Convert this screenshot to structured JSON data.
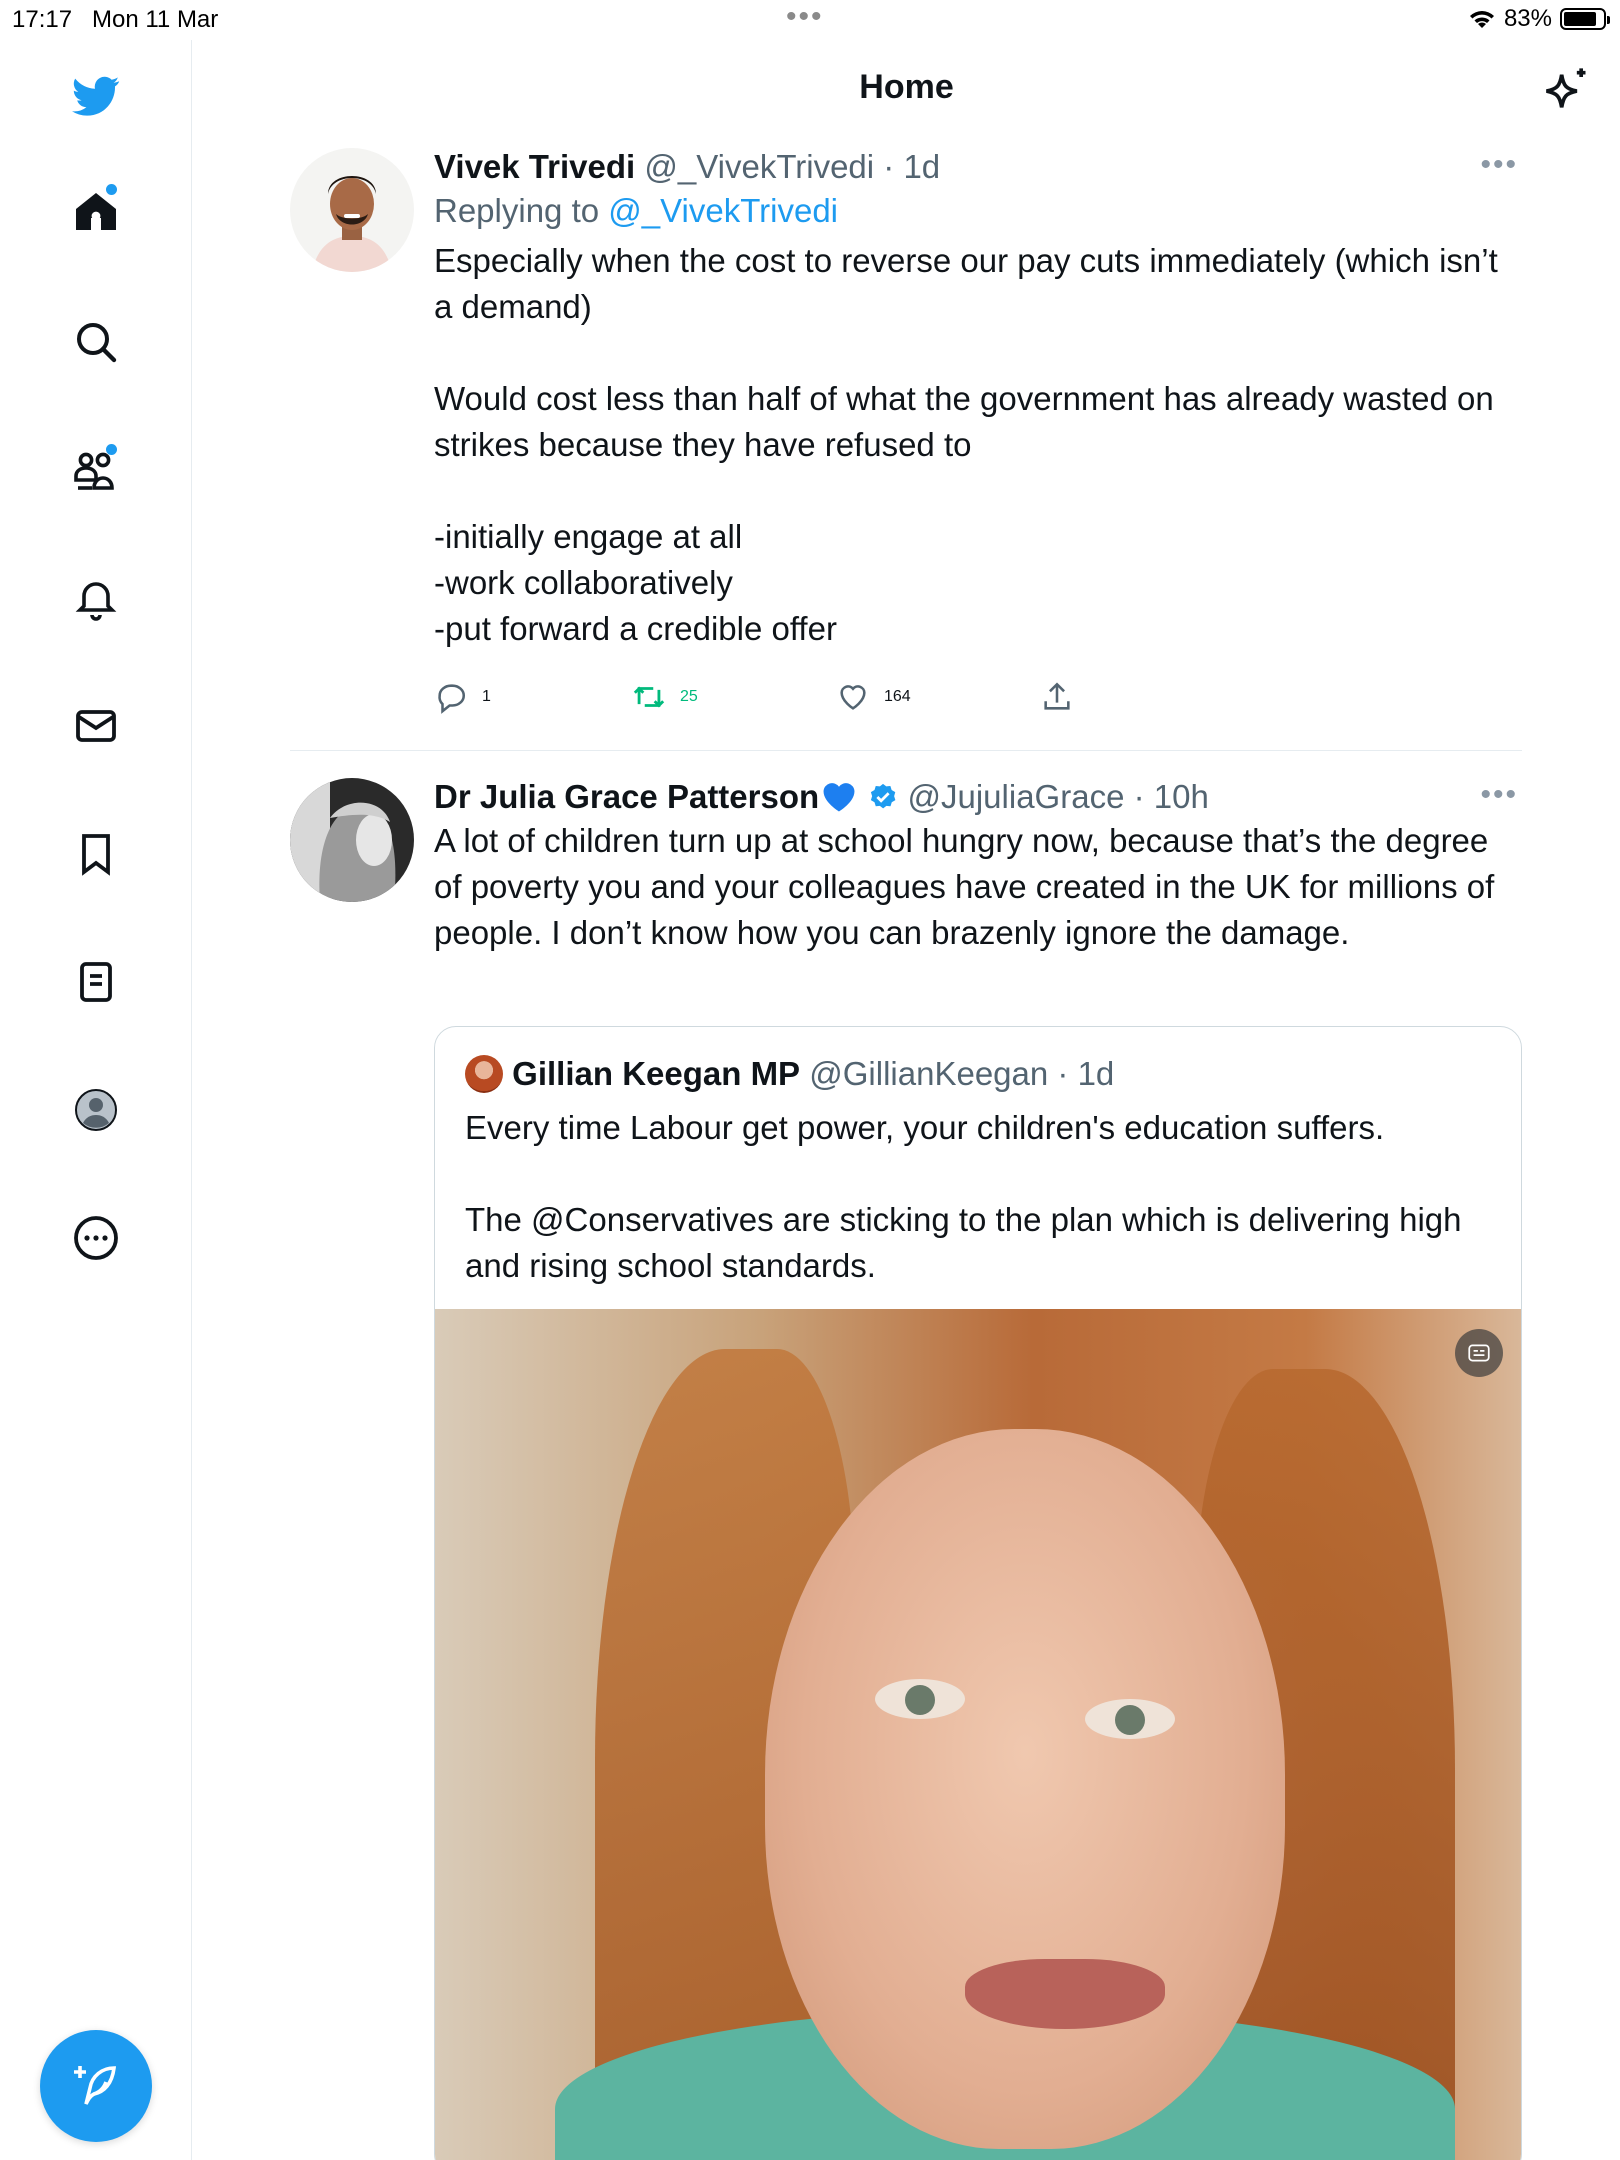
{
  "status_bar": {
    "time": "17:17",
    "date": "Mon 11 Mar",
    "battery": "83%",
    "battery_level": 0.83
  },
  "header": {
    "title": "Home"
  },
  "colors": {
    "accent": "#1d9bf0",
    "retweet_active": "#00ba7c",
    "secondary_text": "#536471"
  },
  "sidebar": {
    "items": [
      {
        "name": "twitter-logo-icon"
      },
      {
        "name": "home-icon"
      },
      {
        "name": "explore-icon"
      },
      {
        "name": "communities-icon"
      },
      {
        "name": "notifications-icon"
      },
      {
        "name": "messages-icon"
      },
      {
        "name": "bookmarks-icon"
      },
      {
        "name": "lists-icon"
      },
      {
        "name": "profile-icon"
      },
      {
        "name": "more-icon"
      }
    ],
    "compose": "compose-icon"
  },
  "tweets": [
    {
      "name": "Vivek Trivedi",
      "handle": "@_VivekTrivedi",
      "time": "· 1d",
      "replying_prefix": "Replying to ",
      "replying_to": "@_VivekTrivedi",
      "text": "Especially when the cost to reverse our pay cuts immediately (which isn’t a demand)\n\nWould cost less than half of what the government has already wasted on strikes because they have refused to\n\n-initially engage at all\n-work collaboratively\n-put forward a credible offer",
      "replies": "1",
      "retweets": "25",
      "likes": "164"
    },
    {
      "name": "Dr Julia Grace Patterson",
      "handle": "@JujuliaGrace",
      "time": "· 10h",
      "text": "A lot of children turn up at school hungry now, because that’s the degree of poverty you and your colleagues have created in the UK for millions of people. I don’t know how you can brazenly ignore the damage.",
      "quote": {
        "name": "Gillian Keegan MP",
        "handle": "@GillianKeegan",
        "time": "· 1d",
        "text": "Every time Labour get power, your children's education suffers.\n\nThe @Conservatives are sticking to the plan which is delivering high and rising school standards."
      }
    }
  ]
}
